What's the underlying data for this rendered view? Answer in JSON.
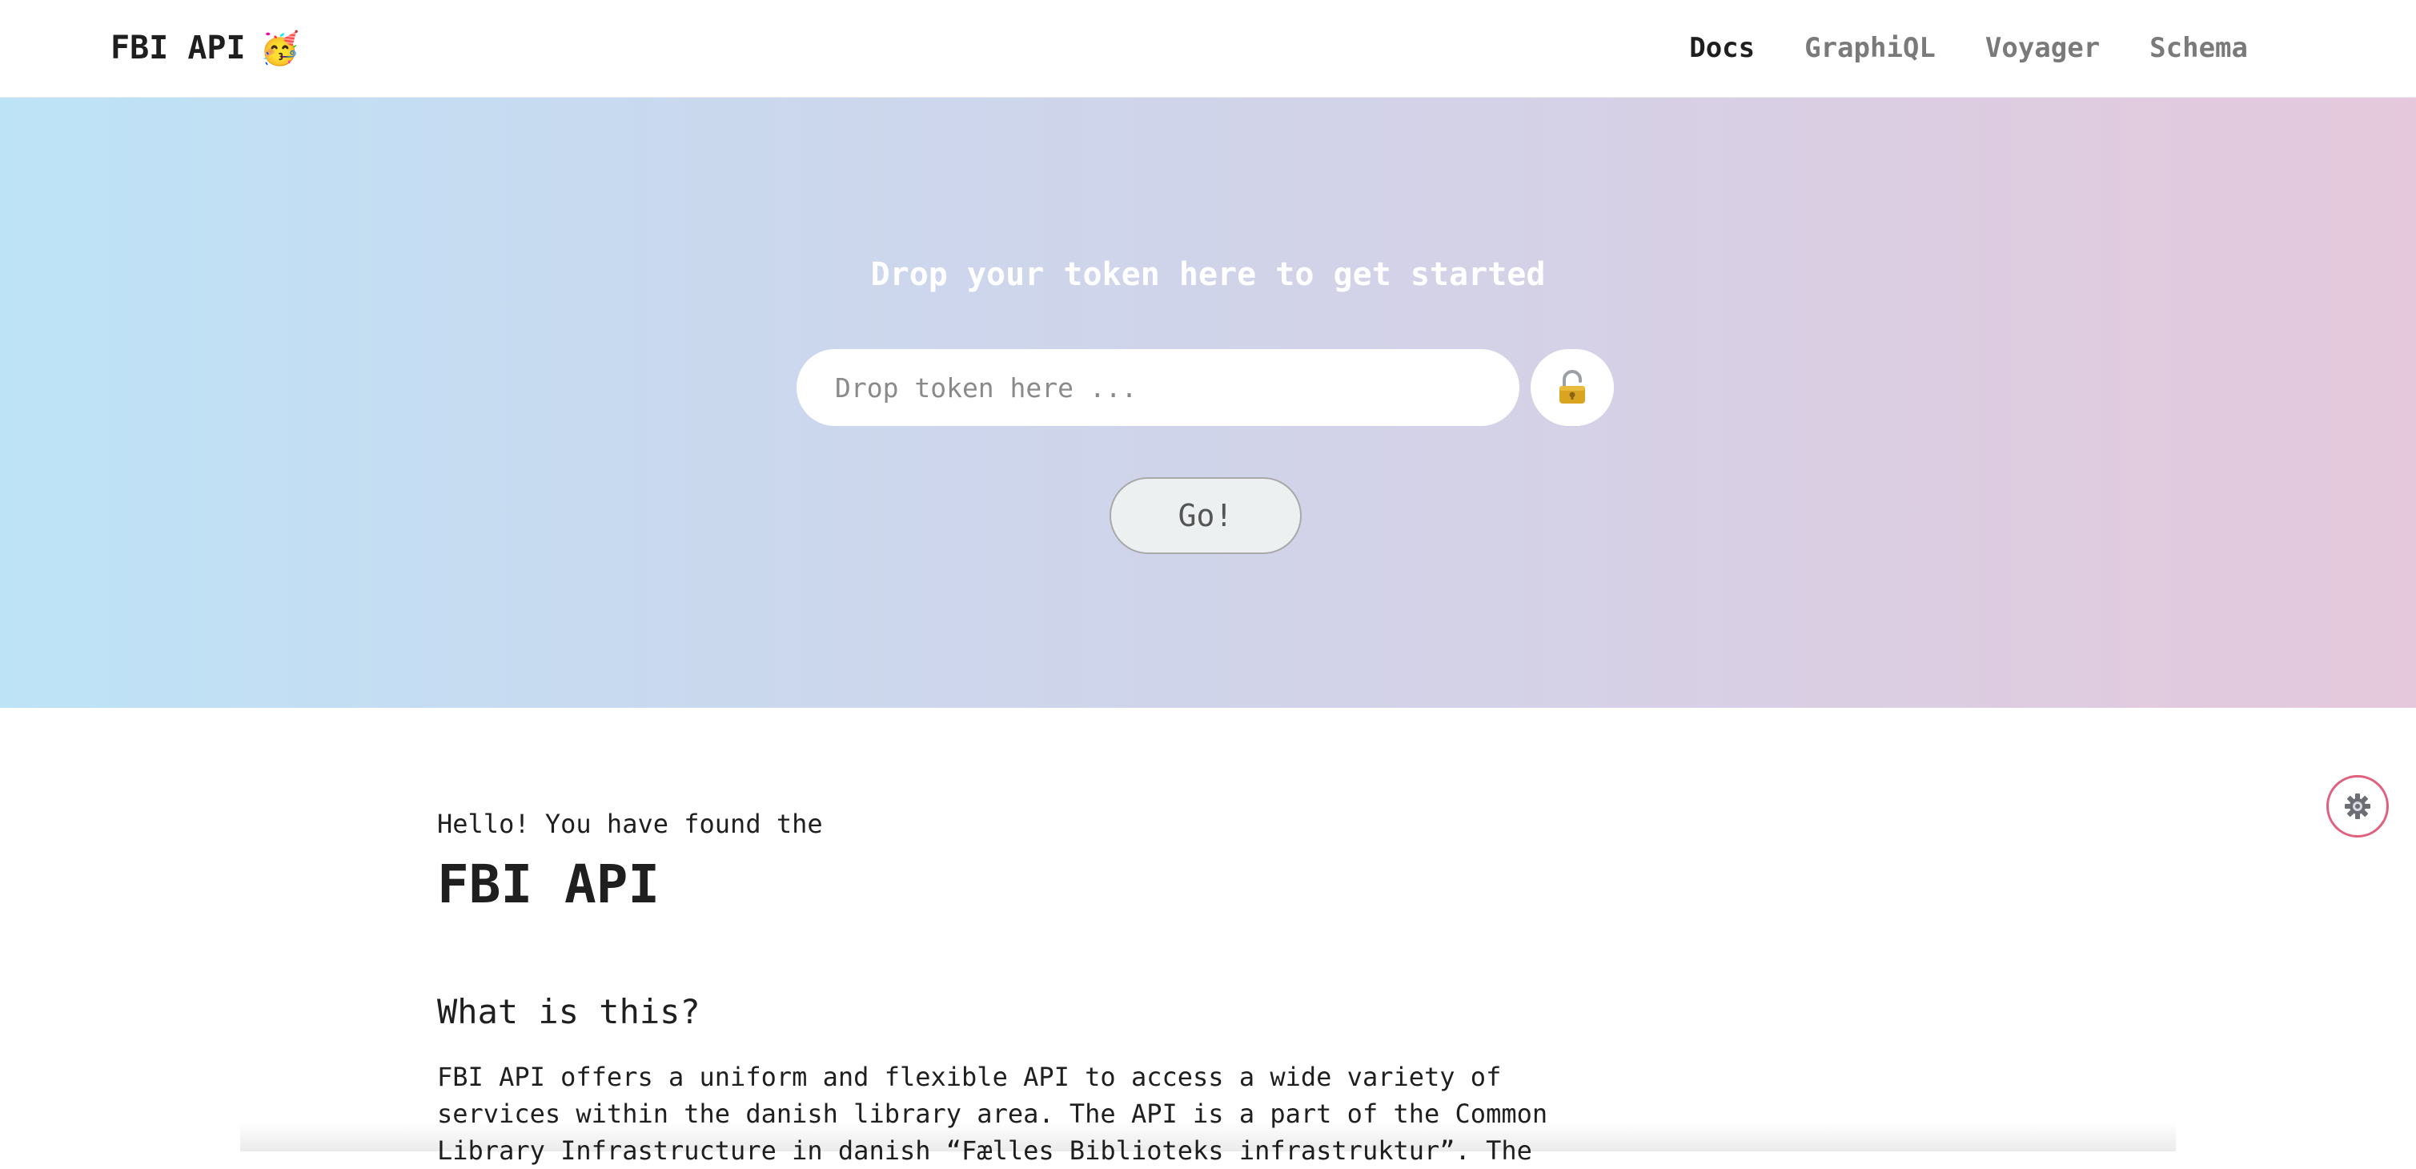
{
  "header": {
    "brand": "FBI API",
    "brand_emoji": "🥳",
    "nav": {
      "docs": "Docs",
      "graphiql": "GraphiQL",
      "voyager": "Voyager",
      "schema": "Schema"
    }
  },
  "hero": {
    "title": "Drop your token here to get started",
    "token_placeholder": "Drop token here ...",
    "lock_icon": "lock-icon",
    "go_label": "Go!"
  },
  "settings": {
    "icon": "gear-icon"
  },
  "content": {
    "intro": "Hello! You have found the",
    "title": "FBI API",
    "section_heading": "What is this?",
    "paragraph": "FBI API offers a uniform and flexible API to access a wide variety of services within the danish library area. The API is a part of the Common Library Infrastructure in danish “Fælles Biblioteks infrastruktur”. The"
  },
  "colors": {
    "hero_gradient_start": "#bde3f7",
    "hero_gradient_end": "#e5c8dc",
    "fab_border": "#e0607e",
    "nav_active": "#1f1f1f",
    "nav_inactive": "#7a7a7a"
  }
}
